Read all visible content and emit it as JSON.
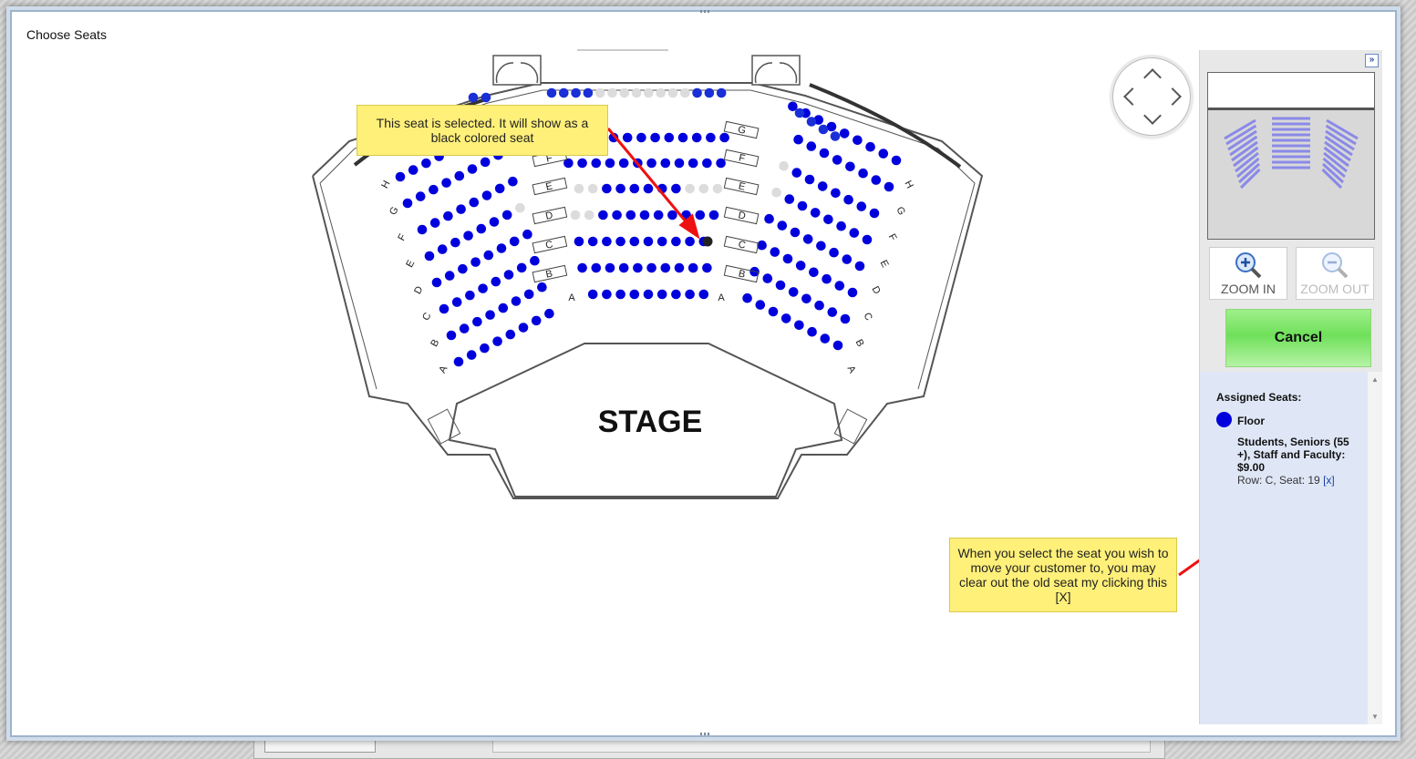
{
  "dialog": {
    "title": "Choose Seats"
  },
  "venue": {
    "stage_label": "STAGE",
    "row_letters": [
      "A",
      "B",
      "C",
      "D",
      "E",
      "F",
      "G",
      "H"
    ],
    "colors": {
      "available": "#0000dd",
      "unavailable": "#dcdcdc",
      "selected": "#222222",
      "wheelchair": "#1a2fd6"
    }
  },
  "panel": {
    "zoom_in_label": "ZOOM IN",
    "zoom_out_label": "ZOOM OUT",
    "cancel_label": "Cancel",
    "assigned": {
      "heading": "Assigned Seats:",
      "section": "Floor",
      "price_line": "Students, Seniors (55 +), Staff and Faculty: $9.00",
      "row_seat": "Row: C, Seat: 19",
      "remove_link": "[x]"
    }
  },
  "callouts": {
    "selected_seat": "This seat is selected. It will show as a black colored seat",
    "clear_old_seat": "When you select the seat you wish to move your customer to, you may clear out the old seat my clicking this [X]"
  },
  "colors": {
    "accent_blue": "#0000dd",
    "cancel_green": "#78e462",
    "callout_yellow": "#fff07a",
    "arrow_red": "#ee1111"
  }
}
